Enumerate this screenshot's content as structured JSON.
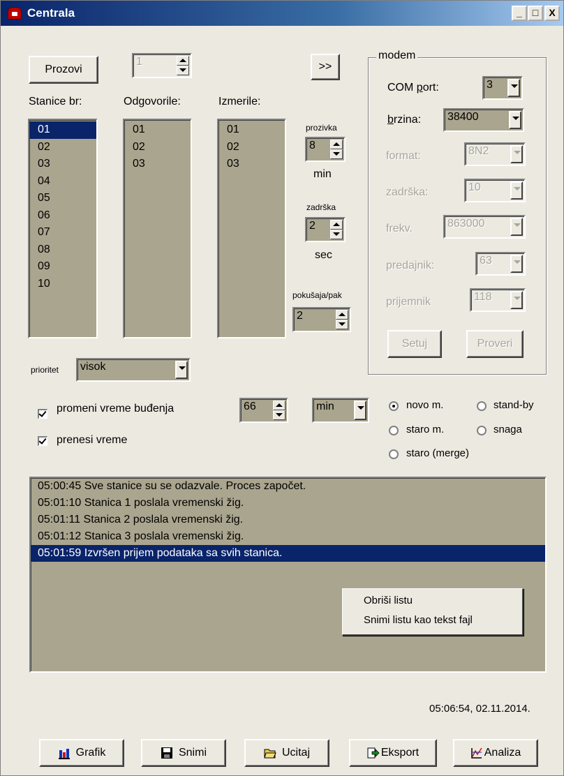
{
  "window": {
    "title": "Centrala",
    "controls": {
      "minimize": "_",
      "maximize": "□",
      "close": "X"
    }
  },
  "top": {
    "prozovi_label": "Prozovi",
    "station_spin_value": "1",
    "more_label": ">>"
  },
  "lists": {
    "stanice_header": "Stanice br:",
    "odgovorile_header": "Odgovorile:",
    "izmerile_header": "Izmerile:",
    "stanice": [
      "01",
      "02",
      "03",
      "04",
      "05",
      "06",
      "07",
      "08",
      "09",
      "10"
    ],
    "stanice_selected": "01",
    "odgovorile": [
      "01",
      "02",
      "03"
    ],
    "izmerile": [
      "01",
      "02",
      "03"
    ]
  },
  "timing": {
    "prozivka_label": "prozivka",
    "prozivka_value": "8",
    "prozivka_unit": "min",
    "zadrska_label": "zadrška",
    "zadrska_value": "2",
    "zadrska_unit": "sec",
    "pokusaja_label": "pokušaja/pak",
    "pokusaja_value": "2"
  },
  "modem": {
    "group_title": "modem",
    "com_port_label": "COM port:",
    "com_port_value": "3",
    "brzina_label": "brzina:",
    "brzina_value": "38400",
    "format_label": "format:",
    "format_value": "8N2",
    "zadrska_label": "zadrška:",
    "zadrska_value": "10",
    "frekv_label": "frekv.",
    "frekv_value": "863000",
    "predajnik_label": "predajnik:",
    "predajnik_value": "63",
    "prijemnik_label": "prijemnik",
    "prijemnik_value": "118",
    "setuj_label": "Setuj",
    "proveri_label": "Proveri"
  },
  "prioritet": {
    "label": "prioritet",
    "value": "visok"
  },
  "options": {
    "promeni_label": "promeni vreme buđenja",
    "promeni_checked": true,
    "wake_value": "66",
    "wake_unit": "min",
    "prenesi_label": "prenesi vreme",
    "prenesi_checked": true
  },
  "mode": {
    "novo": "novo m.",
    "staro": "staro m.",
    "staro_merge": "staro (merge)",
    "standby": "stand-by",
    "snaga": "snaga",
    "selected": "novo m."
  },
  "log": {
    "lines": [
      "05:00:45  Sve stanice su se odazvale. Proces započet.",
      "05:01:10  Stanica 1 poslala vremenski žig.",
      "05:01:11  Stanica 2 poslala vremenski žig.",
      "05:01:12  Stanica 3 poslala vremenski žig.",
      "05:01:59  Izvršen prijem podataka sa svih stanica."
    ],
    "selected_index": 4
  },
  "context_menu": {
    "items": [
      "Obriši listu",
      "Snimi listu kao tekst fajl"
    ]
  },
  "status": {
    "datetime": "05:06:54,  02.11.2014."
  },
  "bottom_buttons": {
    "grafik": "Grafik",
    "snimi": "Snimi",
    "ucitaj": "Ucitaj",
    "eksport": "Eksport",
    "analiza": "Analiza"
  },
  "colors": {
    "titlebar": "#0a246a",
    "face": "#ece9e1",
    "list_bg": "#aaa58e",
    "selection": "#0a246a"
  }
}
